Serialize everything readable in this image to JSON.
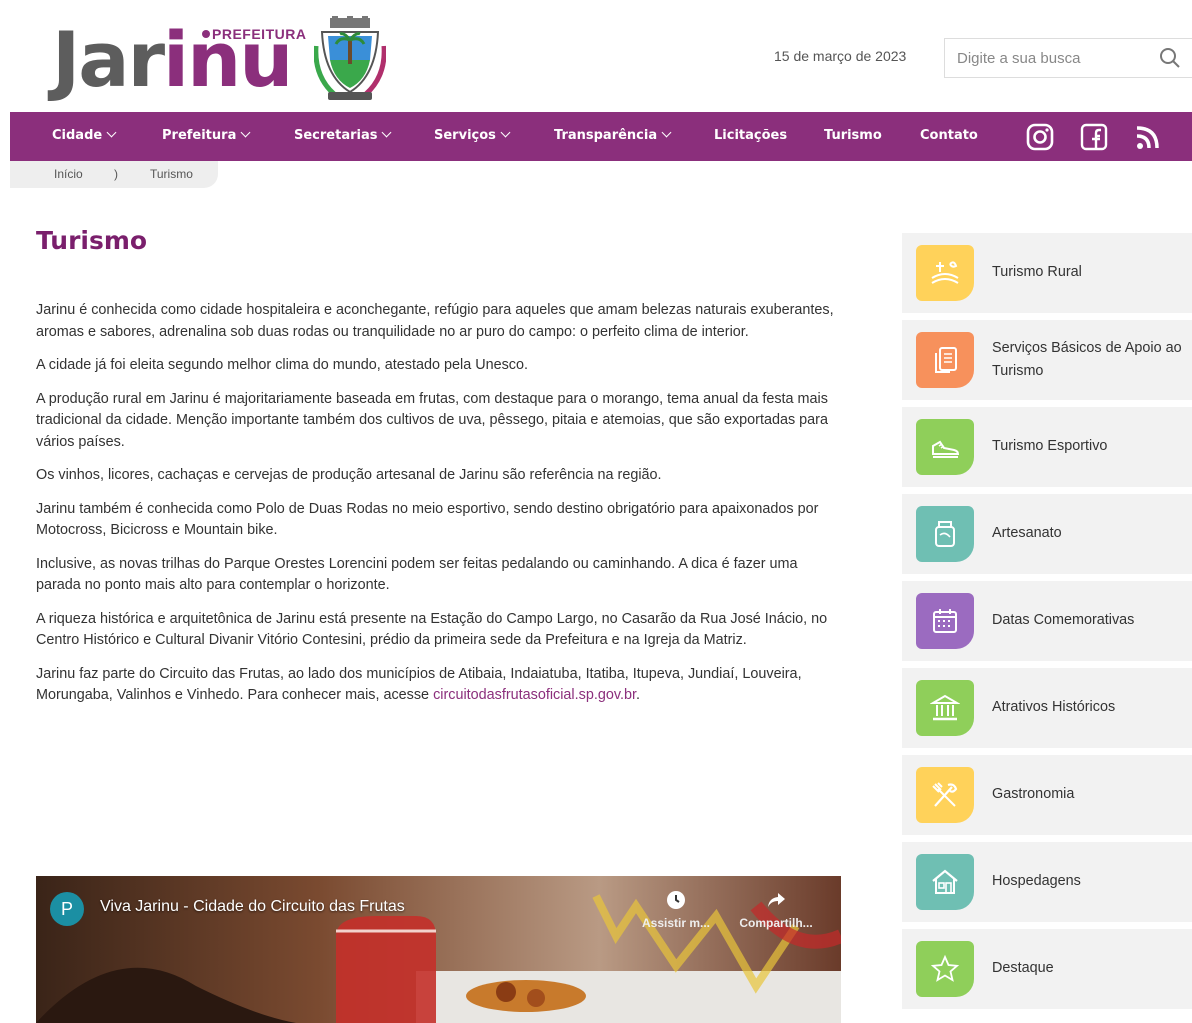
{
  "header": {
    "logo_main": "Jar",
    "logo_accent": "inu",
    "logo_top": "PREFEITURA",
    "date": "15 de março de 2023",
    "search_placeholder": "Digite a sua busca"
  },
  "nav": {
    "items": [
      {
        "label": "Cidade",
        "dropdown": true
      },
      {
        "label": "Prefeitura",
        "dropdown": true
      },
      {
        "label": "Secretarias",
        "dropdown": true
      },
      {
        "label": "Serviços",
        "dropdown": true
      },
      {
        "label": "Transparência",
        "dropdown": true
      },
      {
        "label": "Licitações",
        "dropdown": false
      },
      {
        "label": "Turismo",
        "dropdown": false
      },
      {
        "label": "Contato",
        "dropdown": false
      }
    ],
    "social": [
      "instagram-icon",
      "facebook-icon",
      "rss-icon"
    ]
  },
  "breadcrumb": {
    "home": "Início",
    "separator": ")",
    "current": "Turismo"
  },
  "main": {
    "title": "Turismo",
    "paragraphs": [
      "Jarinu é conhecida como cidade hospitaleira e aconchegante, refúgio para aqueles que amam belezas naturais exuberantes, aromas e sabores, adrenalina sob duas rodas ou tranquilidade no ar puro do campo: o perfeito clima de interior.",
      "A cidade já foi eleita segundo melhor clima do mundo, atestado pela Unesco.",
      "A produção rural em Jarinu é majoritariamente baseada em frutas, com destaque para o morango, tema anual da festa mais tradicional da cidade. Menção importante também dos cultivos de uva, pêssego, pitaia e atemoias, que são exportadas para vários países.",
      "Os vinhos, licores, cachaças e cervejas de produção artesanal de Jarinu são referência na região.",
      "Jarinu também é conhecida como Polo de Duas Rodas no meio esportivo, sendo destino obrigatório para apaixonados por Motocross, Bicicross e Mountain bike.",
      "Inclusive, as novas trilhas do Parque Orestes Lorencini podem ser feitas pedalando ou caminhando. A dica é fazer uma parada no ponto mais alto para contemplar o horizonte.",
      "A riqueza histórica e arquitetônica de Jarinu está presente na Estação do Campo Largo, no Casarão da Rua José Inácio, no Centro Histórico e Cultural Divanir Vitório Contesini, prédio da primeira sede da Prefeitura e na Igreja da Matriz."
    ],
    "last_paragraph_text": "Jarinu faz parte do Circuito das Frutas, ao lado dos municípios de Atibaia, Indaiatuba, Itatiba, Itupeva, Jundiaí, Louveira, Morungaba, Valinhos e Vinhedo. Para conhecer mais, acesse ",
    "last_paragraph_link": "circuitodasfrutasoficial.sp.gov.br",
    "last_paragraph_end": "."
  },
  "video": {
    "avatar_letter": "P",
    "title": "Viva Jarinu - Cidade do Circuito das Frutas",
    "watch_later": "Assistir m...",
    "share": "Compartilh..."
  },
  "sidebar": {
    "items": [
      {
        "label": "Turismo Rural",
        "color": "#ffd25a",
        "icon": "farm-icon"
      },
      {
        "label": "Serviços Básicos de Apoio ao Turismo",
        "color": "#f7915c",
        "icon": "documents-icon"
      },
      {
        "label": "Turismo Esportivo",
        "color": "#8fcf5a",
        "icon": "sneaker-icon"
      },
      {
        "label": "Artesanato",
        "color": "#6fbfb3",
        "icon": "craft-jar-icon"
      },
      {
        "label": "Datas Comemorativas",
        "color": "#9b6bc0",
        "icon": "calendar-icon"
      },
      {
        "label": "Atrativos Históricos",
        "color": "#8fcf5a",
        "icon": "museum-icon"
      },
      {
        "label": "Gastronomia",
        "color": "#ffd25a",
        "icon": "cutlery-icon"
      },
      {
        "label": "Hospedagens",
        "color": "#6fbfb3",
        "icon": "house-icon"
      },
      {
        "label": "Destaque",
        "color": "#8fcf5a",
        "icon": "star-icon"
      }
    ]
  },
  "colors": {
    "brand_purple": "#8b2f7c",
    "title_purple": "#7a1f6c"
  }
}
